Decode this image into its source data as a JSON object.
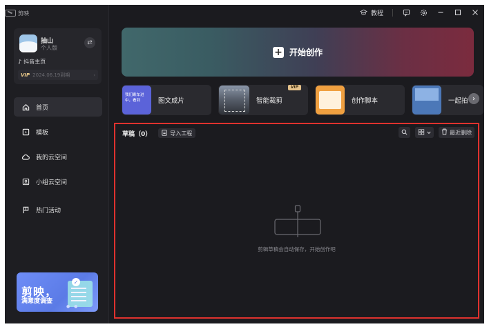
{
  "app": {
    "name": "剪映"
  },
  "profile": {
    "name": "抽山",
    "plan": "个人版",
    "douyin_link": "抖音主页",
    "vip_badge": "VIP",
    "vip_expiry": "2024.06.19到期"
  },
  "titlebar": {
    "tutorial": "教程"
  },
  "nav": [
    {
      "label": "首页",
      "icon": "home-icon",
      "active": true
    },
    {
      "label": "模板",
      "icon": "template-icon",
      "active": false
    },
    {
      "label": "我的云空间",
      "icon": "cloud-icon",
      "active": false
    },
    {
      "label": "小组云空间",
      "icon": "team-cloud-icon",
      "active": false
    },
    {
      "label": "热门活动",
      "icon": "flag-icon",
      "active": false
    }
  ],
  "banner": {
    "label": "开始创作"
  },
  "tools": [
    {
      "label": "图文成片",
      "thumb_text": "我们乘车进中，看到"
    },
    {
      "label": "智能裁剪",
      "vip": "VIP"
    },
    {
      "label": "创作脚本"
    },
    {
      "label": "一起拍"
    }
  ],
  "drafts": {
    "title": "草稿（0）",
    "import": "导入工程",
    "recent_delete": "最近删除",
    "empty_text": "剪辑草稿会自动保存，开始创作吧"
  },
  "survey": {
    "line1": "剪映，",
    "line2": "满意度调查"
  }
}
